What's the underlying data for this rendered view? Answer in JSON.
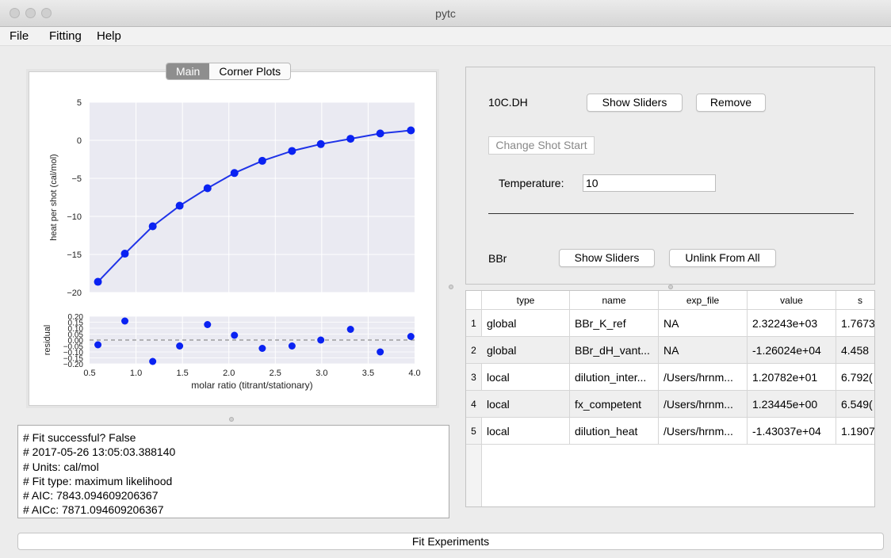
{
  "window": {
    "title": "pytc"
  },
  "menu": {
    "items": [
      "File",
      "Fitting",
      "Help"
    ]
  },
  "plot_tabs": {
    "main": "Main",
    "corner": "Corner Plots"
  },
  "chart_data": [
    {
      "type": "line",
      "ylabel": "heat per shot (cal/mol)",
      "ylim": [
        -20,
        5
      ],
      "yticks": [
        5,
        0,
        -5,
        -10,
        -15,
        -20
      ],
      "xlim": [
        0.5,
        4.0
      ],
      "grid": true,
      "series": [
        {
          "x": [
            0.59,
            0.88,
            1.18,
            1.47,
            1.77,
            2.06,
            2.36,
            2.68,
            2.99,
            3.31,
            3.63,
            3.96
          ],
          "y": [
            -18.6,
            -14.9,
            -11.3,
            -8.6,
            -6.3,
            -4.3,
            -2.7,
            -1.4,
            -0.5,
            0.2,
            0.9,
            1.3
          ]
        }
      ]
    },
    {
      "type": "scatter",
      "ylabel": "residual",
      "xlabel": "molar ratio (titrant/stationary)",
      "xlim": [
        0.5,
        4.0
      ],
      "ylim": [
        -0.2,
        0.2
      ],
      "xticks": [
        "0.5",
        "1.0",
        "1.5",
        "2.0",
        "2.5",
        "3.0",
        "3.5",
        "4.0"
      ],
      "yticks": [
        "0.20",
        "0.15",
        "0.10",
        "0.05",
        "0.00",
        "−0.05",
        "−0.10",
        "−0.15",
        "−0.20"
      ],
      "zero_line": "dashed",
      "series": [
        {
          "x": [
            0.59,
            0.88,
            1.18,
            1.47,
            1.77,
            2.06,
            2.36,
            2.68,
            2.99,
            3.31,
            3.63,
            3.96
          ],
          "y": [
            -0.04,
            0.16,
            -0.18,
            -0.05,
            0.13,
            0.04,
            -0.07,
            -0.05,
            0.0,
            0.09,
            -0.1,
            0.03
          ]
        }
      ]
    }
  ],
  "experiment": {
    "name": "10C.DH",
    "show_sliders": "Show Sliders",
    "remove": "Remove",
    "change_shot_start": "Change Shot Start",
    "temperature_label": "Temperature:",
    "temperature_value": "10"
  },
  "global_param": {
    "name": "BBr",
    "show_sliders": "Show Sliders",
    "unlink": "Unlink From All"
  },
  "table": {
    "columns": [
      "type",
      "name",
      "exp_file",
      "value",
      "s"
    ],
    "rows": [
      {
        "n": "1",
        "type": "global",
        "name": "BBr_K_ref",
        "exp_file": "NA",
        "value": "2.32243e+03",
        "s": "1.7673"
      },
      {
        "n": "2",
        "type": "global",
        "name": "BBr_dH_vant...",
        "exp_file": "NA",
        "value": "-1.26024e+04",
        "s": "4.458"
      },
      {
        "n": "3",
        "type": "local",
        "name": "dilution_inter...",
        "exp_file": "/Users/hrnm...",
        "value": "1.20782e+01",
        "s": "6.792("
      },
      {
        "n": "4",
        "type": "local",
        "name": "fx_competent",
        "exp_file": "/Users/hrnm...",
        "value": "1.23445e+00",
        "s": "6.549("
      },
      {
        "n": "5",
        "type": "local",
        "name": "dilution_heat",
        "exp_file": "/Users/hrnm...",
        "value": "-1.43037e+04",
        "s": "1.1907"
      }
    ]
  },
  "log": {
    "lines": [
      "# Fit successful? False",
      "# 2017-05-26 13:05:03.388140",
      "# Units: cal/mol",
      "# Fit type: maximum likelihood",
      "# AIC: 7843.094609206367",
      "# AICc: 7871.094609206367"
    ]
  },
  "fit_button": "Fit Experiments"
}
